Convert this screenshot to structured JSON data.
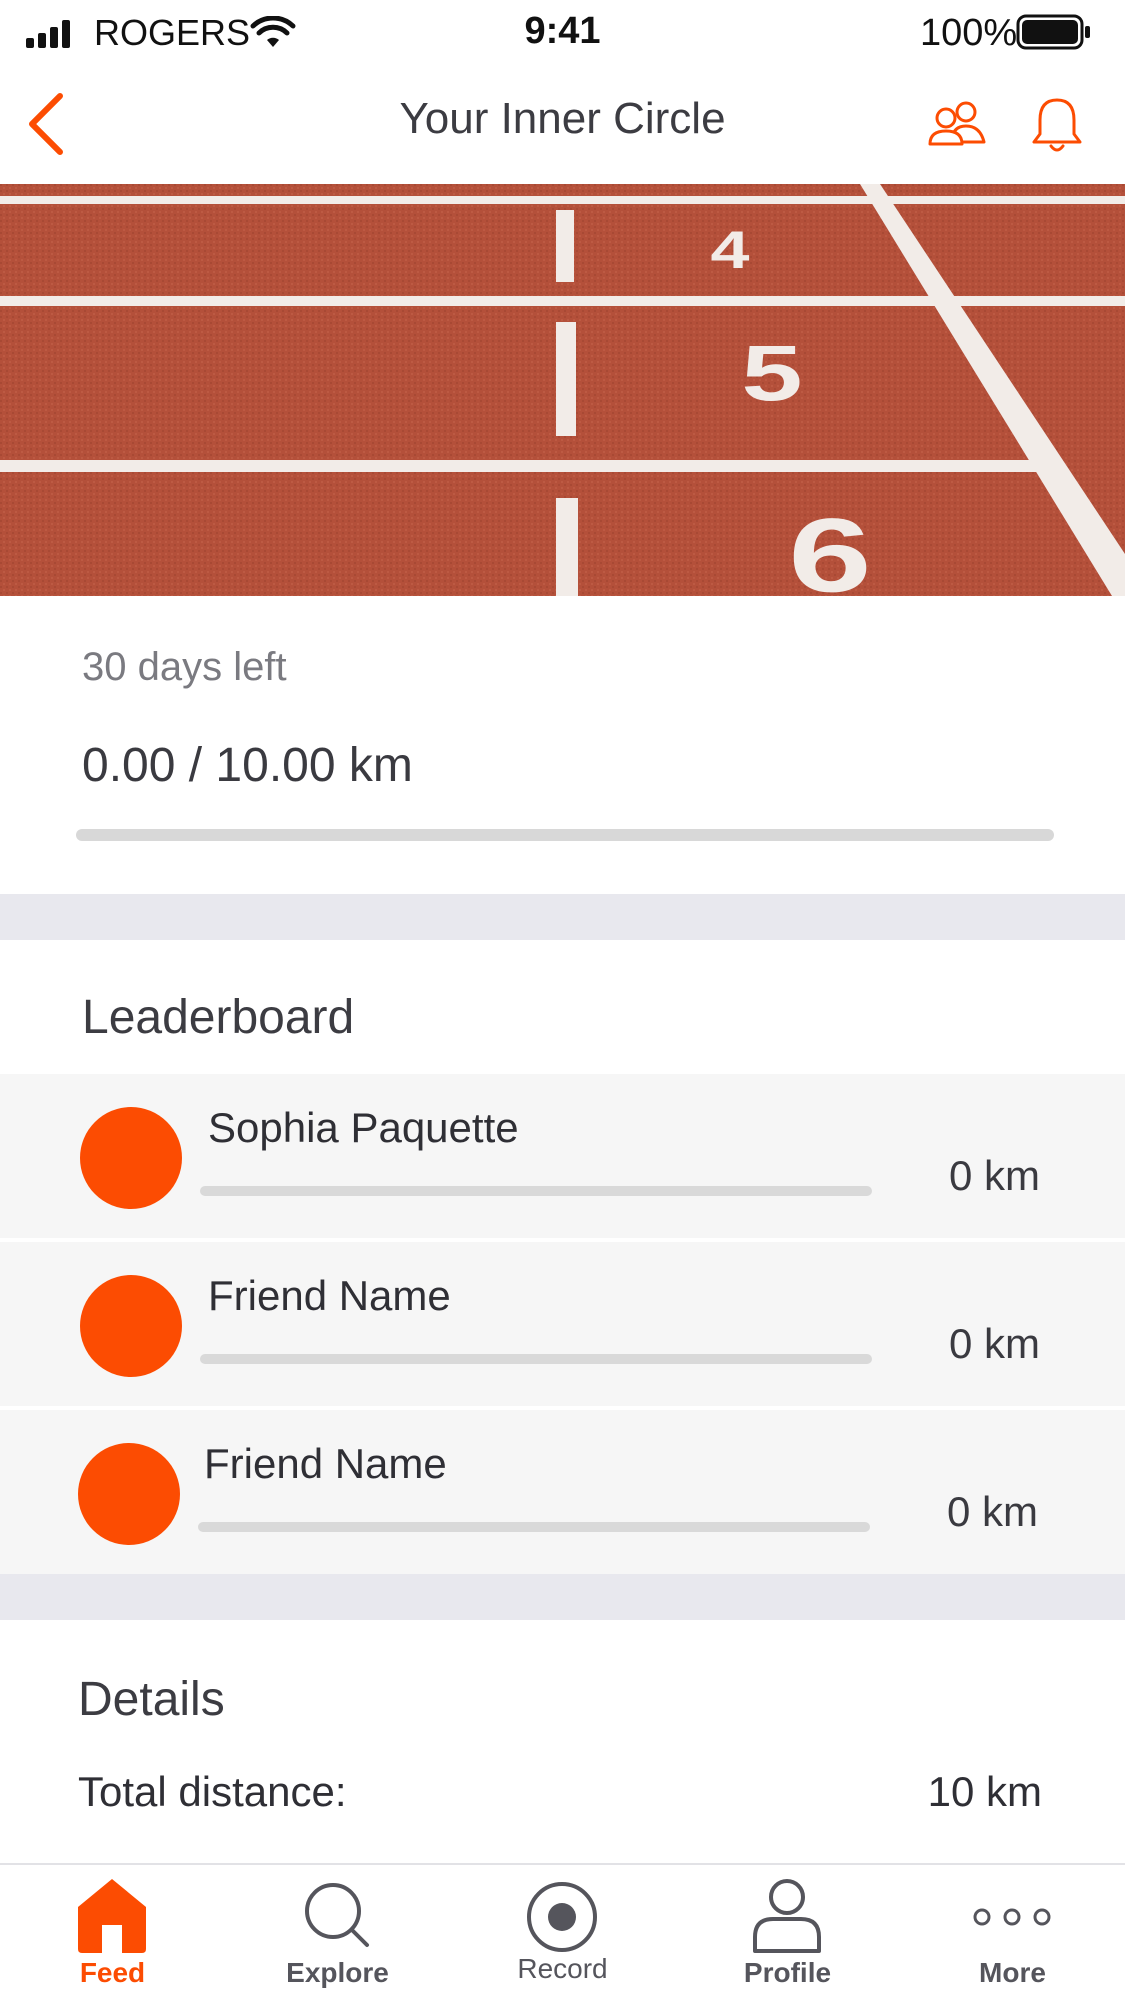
{
  "status_bar": {
    "carrier": "ROGERS",
    "time": "9:41",
    "battery": "100%"
  },
  "nav": {
    "title": "Your Inner Circle"
  },
  "hero": {
    "lane_numbers": [
      "4",
      "5",
      "6"
    ]
  },
  "challenge": {
    "days_left": "30 days left",
    "distance": "0.00 / 10.00 km",
    "progress_fraction": 0.0
  },
  "leaderboard": {
    "title": "Leaderboard",
    "entries": [
      {
        "name": "Sophia Paquette",
        "value": "0 km",
        "progress_fraction": 0.0
      },
      {
        "name": "Friend Name",
        "value": "0 km",
        "progress_fraction": 0.0
      },
      {
        "name": "Friend Name",
        "value": "0 km",
        "progress_fraction": 0.0
      }
    ]
  },
  "details": {
    "title": "Details",
    "total_distance_label": "Total distance:",
    "total_distance_value": "10 km"
  },
  "tabs": [
    {
      "label": "Feed"
    },
    {
      "label": "Explore"
    },
    {
      "label": "Record"
    },
    {
      "label": "Profile"
    },
    {
      "label": "More"
    }
  ],
  "colors": {
    "accent": "#fc4c02",
    "track": "#b04a35",
    "divider": "#e8e8ee"
  }
}
